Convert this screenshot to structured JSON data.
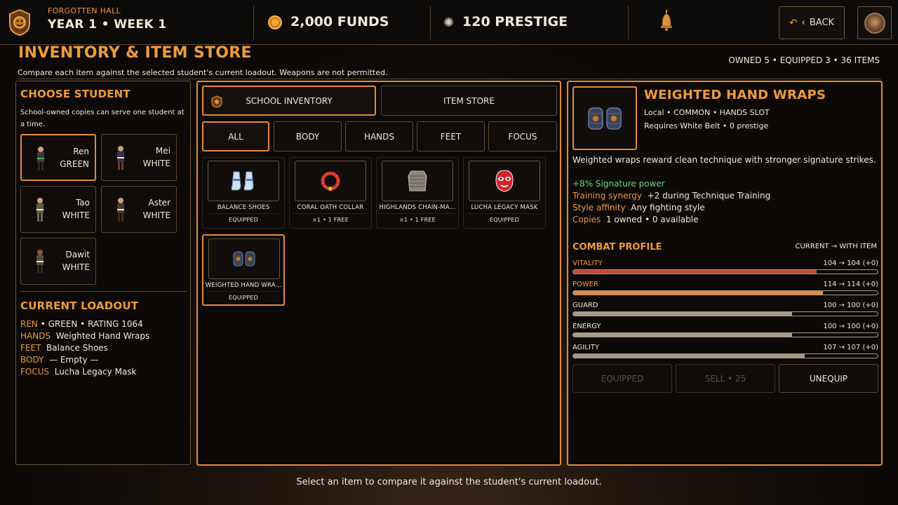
{
  "topbar": {
    "hall_name": "FORGOTTEN HALL",
    "date": "YEAR 1  •  WEEK 1",
    "funds": "2,000 FUNDS",
    "prestige": "120 PRESTIGE",
    "back_label": "BACK",
    "icons": [
      "crest-icon",
      "coin-icon",
      "sparkle-icon",
      "bell-icon",
      "back-arrow-icon",
      "avatar"
    ]
  },
  "header": {
    "title": "INVENTORY & ITEM STORE",
    "subtitle": "Compare each item against the selected student's current loadout. Weapons are not permitted.",
    "stats": "OWNED 5  •  EQUIPPED 3  •  36 ITEMS"
  },
  "left": {
    "choose_title": "CHOOSE STUDENT",
    "choose_desc": "School-owned copies can serve one student at a time.",
    "students": [
      {
        "name": "Ren",
        "belt": "GREEN",
        "selected": true
      },
      {
        "name": "Mei",
        "belt": "WHITE",
        "selected": false
      },
      {
        "name": "Tao",
        "belt": "WHITE",
        "selected": false
      },
      {
        "name": "Aster",
        "belt": "WHITE",
        "selected": false
      },
      {
        "name": "Dawit",
        "belt": "WHITE",
        "selected": false
      }
    ],
    "loadout_title": "CURRENT LOADOUT",
    "loadout": {
      "student_key": "REN",
      "student_rest": " • GREEN • RATING 1064",
      "hands_key": "HANDS",
      "hands_val": "Weighted Hand Wraps",
      "feet_key": "FEET",
      "feet_val": "Balance Shoes",
      "body_key": "BODY",
      "body_val": "— Empty —",
      "focus_key": "FOCUS",
      "focus_val": "Lucha Legacy Mask"
    }
  },
  "middle": {
    "source_tabs": [
      {
        "label": "SCHOOL INVENTORY",
        "selected": true
      },
      {
        "label": "ITEM STORE",
        "selected": false
      }
    ],
    "filter_tabs": [
      {
        "label": "ALL",
        "selected": true
      },
      {
        "label": "BODY",
        "selected": false
      },
      {
        "label": "HANDS",
        "selected": false
      },
      {
        "label": "FEET",
        "selected": false
      },
      {
        "label": "FOCUS",
        "selected": false
      }
    ],
    "items": [
      {
        "name": "BALANCE SHOES",
        "status": "EQUIPPED",
        "icon": "shoes-icon"
      },
      {
        "name": "CORAL OATH COLLAR",
        "status": "×1 • 1 FREE",
        "icon": "collar-icon"
      },
      {
        "name": "HIGHLANDS CHAIN-MA...",
        "status": "×1 • 1 FREE",
        "icon": "chainmail-icon"
      },
      {
        "name": "LUCHA LEGACY MASK",
        "status": "EQUIPPED",
        "icon": "mask-icon"
      },
      {
        "name": "WEIGHTED HAND WRA...",
        "status": "EQUIPPED",
        "icon": "hand-wraps-icon",
        "selected": true
      }
    ]
  },
  "detail": {
    "name": "WEIGHTED HAND WRAPS",
    "meta": "Local • COMMON • HANDS SLOT",
    "requirement": "Requires White Belt • 0 prestige",
    "description": "Weighted wraps reward clean technique with stronger signature strikes.",
    "bonus": "+8% Signature power",
    "synergy_key": "Training synergy",
    "synergy_val": "+2 during Technique Training",
    "style_key": "Style affinity",
    "style_val": "Any fighting style",
    "copies_key": "Copies",
    "copies_val": "1 owned • 0 available",
    "combat_title": "COMBAT PROFILE",
    "combat_legend": "CURRENT  →  WITH ITEM",
    "stats": [
      {
        "name": "VITALITY",
        "value": "104  →  104  (+0)",
        "fill": 0.8,
        "color": "#c24a2f",
        "highlight": true
      },
      {
        "name": "POWER",
        "value": "114  →  114  (+0)",
        "fill": 0.82,
        "color": "#e38a35",
        "highlight": true
      },
      {
        "name": "GUARD",
        "value": "100  →  100  (+0)",
        "fill": 0.72,
        "color": "#a89a86",
        "highlight": false
      },
      {
        "name": "ENERGY",
        "value": "100  →  100  (+0)",
        "fill": 0.72,
        "color": "#a89a86",
        "highlight": false
      },
      {
        "name": "AGILITY",
        "value": "107  →  107  (+0)",
        "fill": 0.76,
        "color": "#a89a86",
        "highlight": false
      }
    ],
    "actions": [
      {
        "label": "EQUIPPED",
        "enabled": false
      },
      {
        "label": "SELL • 25",
        "enabled": false
      },
      {
        "label": "UNEQUIP",
        "enabled": true
      }
    ]
  },
  "footer": {
    "hint": "Select an item to compare it against the student's current loadout."
  },
  "colors": {
    "accent": "#e38a35",
    "title": "#f09a3a",
    "bonus_green": "#6ed08a",
    "vitality": "#c24a2f"
  }
}
